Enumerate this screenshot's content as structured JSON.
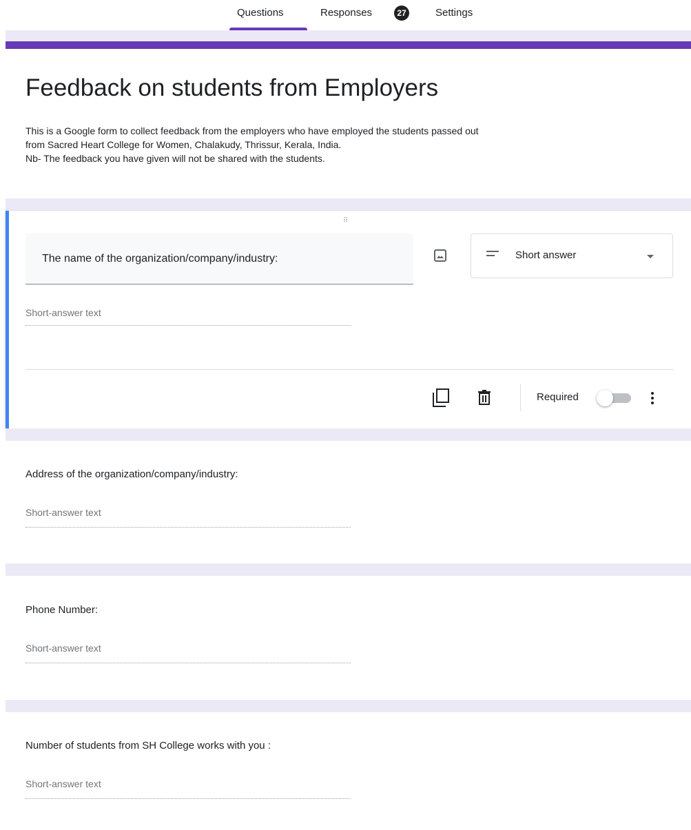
{
  "tabs": {
    "questions": "Questions",
    "responses": "Responses",
    "responses_count": "27",
    "settings": "Settings"
  },
  "form": {
    "title": "Feedback on students from Employers",
    "description_lines": [
      "This is a Google form to collect feedback from the employers who have employed the students passed out",
      "from Sacred Heart College for Women, Chalakudy, Thrissur, Kerala, India.",
      "Nb- The feedback you have given will not be shared with the students."
    ]
  },
  "active_question": {
    "title": "The name of the organization/company/industry:",
    "type": "Short answer",
    "placeholder": "Short-answer text",
    "required_label": "Required",
    "required": false
  },
  "questions": [
    {
      "title": "Address of the organization/company/industry:",
      "placeholder": "Short-answer text"
    },
    {
      "title": "Phone Number:",
      "placeholder": "Short-answer text"
    },
    {
      "title": "Number of students from SH College works with you :",
      "placeholder": "Short-answer text"
    }
  ],
  "colors": {
    "accent": "#673ab7",
    "band": "#ece9f6",
    "focus": "#4285f4"
  },
  "icons": [
    "drag-handle-icon",
    "image-icon",
    "short-answer-icon",
    "dropdown-caret-icon",
    "copy-icon",
    "delete-icon",
    "more-vert-icon"
  ]
}
